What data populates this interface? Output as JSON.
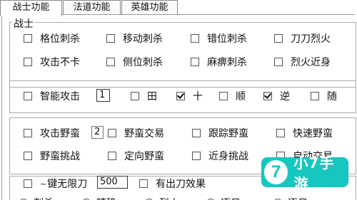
{
  "tabs": [
    "战士功能",
    "法道功能",
    "英雄功能"
  ],
  "warrior_group": {
    "title": "战士",
    "row1": [
      {
        "label": "格位刺杀",
        "checked": false
      },
      {
        "label": "移动刺杀",
        "checked": false
      },
      {
        "label": "错位刺杀",
        "checked": false
      },
      {
        "label": "刀刀烈火",
        "checked": false
      }
    ],
    "row2": [
      {
        "label": "攻击不卡",
        "checked": false
      },
      {
        "label": "侧位刺杀",
        "checked": false
      },
      {
        "label": "麻痹刺杀",
        "checked": false
      },
      {
        "label": "烈火近身",
        "checked": false
      }
    ]
  },
  "smart_attack": {
    "label": "智能攻击",
    "value": "1",
    "options": [
      {
        "label": "田",
        "checked": false
      },
      {
        "label": "十",
        "checked": true
      },
      {
        "label": "顺",
        "checked": false
      },
      {
        "label": "逆",
        "checked": true
      },
      {
        "label": "随",
        "checked": false
      }
    ]
  },
  "barbarian": {
    "attack_label": "攻击野蛮",
    "attack_value": "2",
    "row1": [
      {
        "label": "野蛮交易",
        "checked": false
      },
      {
        "label": "跟踪野蛮",
        "checked": false
      },
      {
        "label": "快速野蛮",
        "checked": false
      }
    ],
    "row2": [
      {
        "label": "野蛮挑战",
        "checked": false
      },
      {
        "label": "定向野蛮",
        "checked": false
      },
      {
        "label": "近身挑战",
        "checked": false
      },
      {
        "label": "自动交易",
        "checked": false
      }
    ]
  },
  "blade": {
    "label": "键无限刀",
    "value": "500",
    "effect_label": "有出刀效果"
  },
  "bottom_radios": [
    "刺杀",
    "精确",
    "烈火",
    "逐日",
    "逐日"
  ],
  "watermark": {
    "text": "小7手游",
    "icon": "7"
  }
}
